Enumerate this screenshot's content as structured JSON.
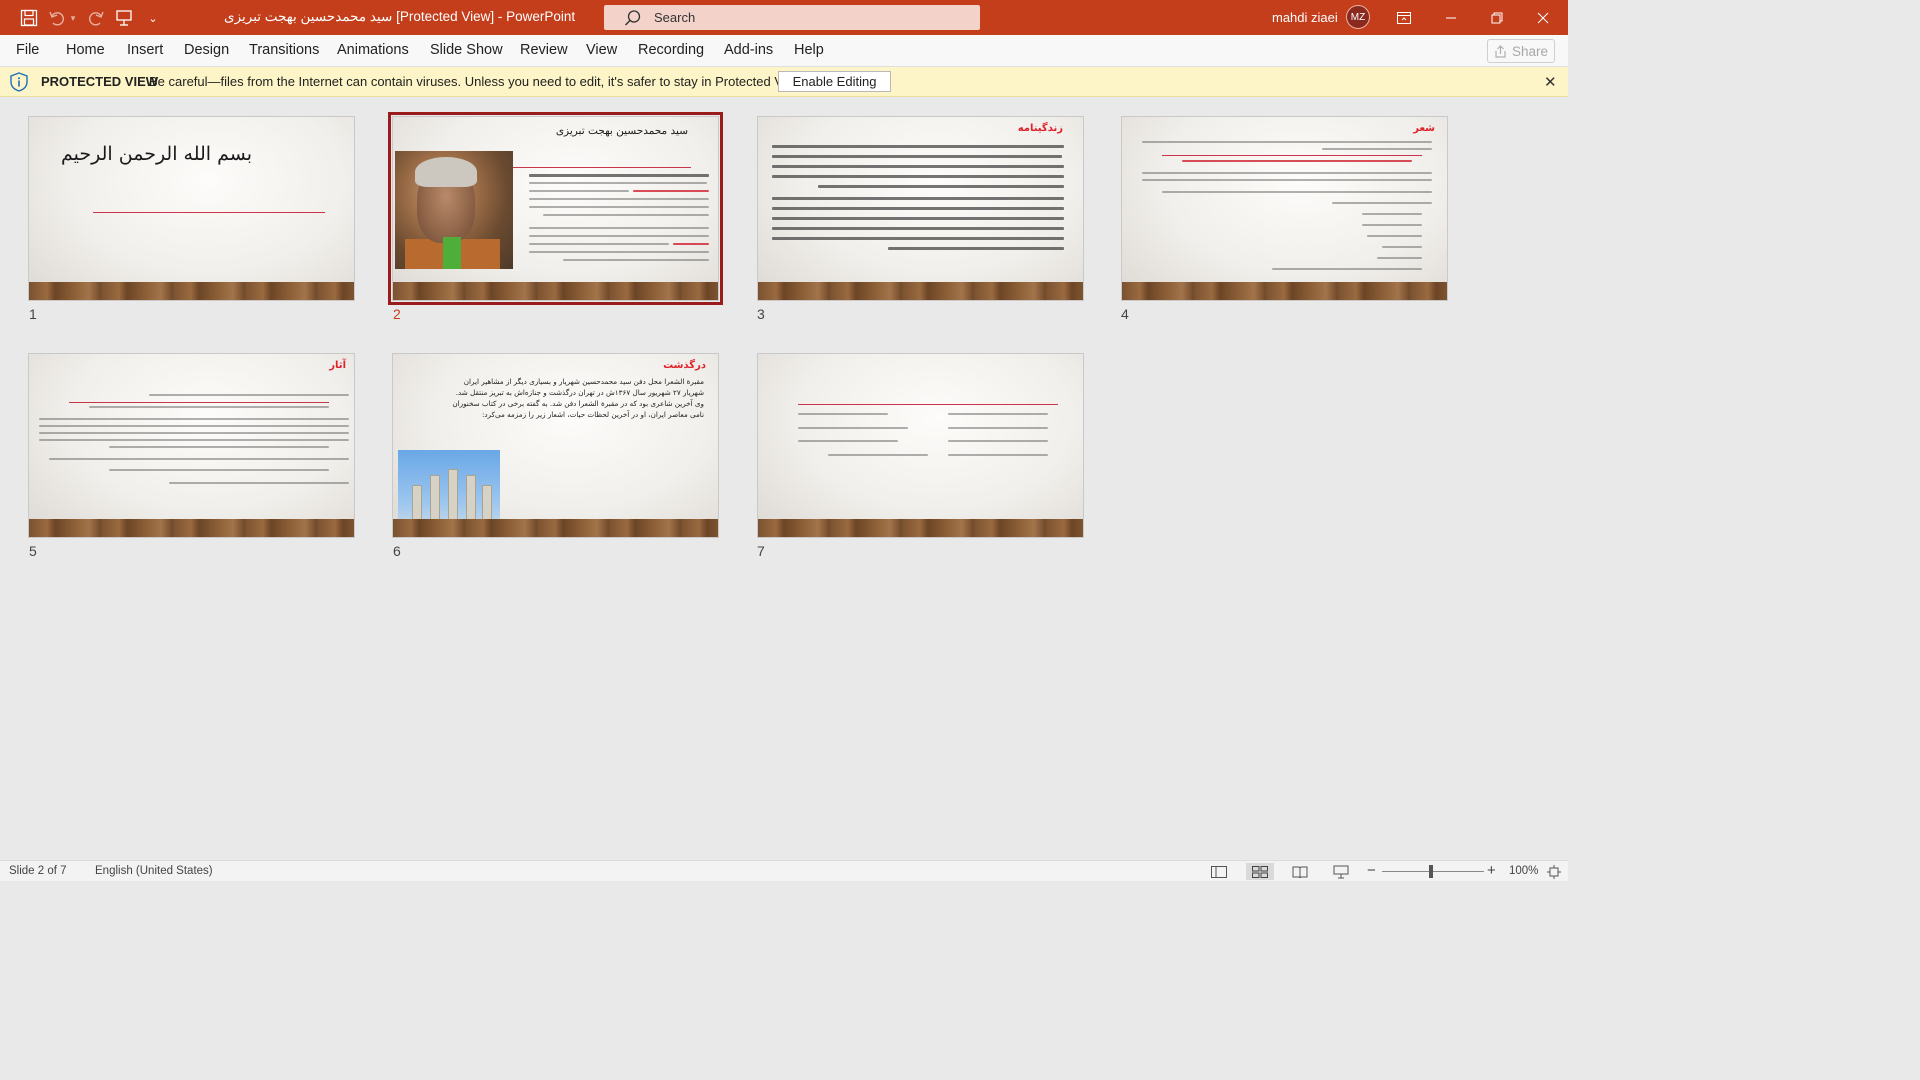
{
  "app": {
    "window_title": "سید محمدحسین بهجت تبریزی [Protected View]  -  PowerPoint",
    "search_placeholder": "Search",
    "user_name": "mahdi ziaei",
    "user_initials": "MZ",
    "brand_color": "#c43e1c"
  },
  "menu": {
    "items": [
      "File",
      "Home",
      "Insert",
      "Design",
      "Transitions",
      "Animations",
      "Slide Show",
      "Review",
      "View",
      "Recording",
      "Add-ins",
      "Help"
    ],
    "share_label": "Share"
  },
  "protected_view": {
    "title": "PROTECTED VIEW",
    "message": "Be careful—files from the Internet can contain viruses. Unless you need to edit, it's safer to stay in Protected View.",
    "button_label": "Enable Editing"
  },
  "slides": [
    {
      "number": "1",
      "title": "بسم الله الرحمن الرحیم",
      "selected": false
    },
    {
      "number": "2",
      "title": "سید محمدحسین بهجت تبریزی",
      "selected": true
    },
    {
      "number": "3",
      "title": "زندگینامه",
      "selected": false
    },
    {
      "number": "4",
      "title": "شعر",
      "selected": false
    },
    {
      "number": "5",
      "title": "آثار",
      "selected": false
    },
    {
      "number": "6",
      "title": "درگذشت",
      "selected": false,
      "lines": [
        "مقبرة الشعرا محل دفن سید محمدحسین شهریار و بسیاری دیگر از مشاهیر ایران",
        "شهریار ۲۷ شهریور سال ۱۳۶۷ش در تهران درگذشت و جنازه‌اش به تبریز منتقل شد.",
        "وی آخرین شاعری بود که در مقبرة الشعرا دفن شد. به گفته برخی در کتاب سخنوران",
        "نامی معاصر ایران، او در آخرین لحظات حیات، اشعار زیر را زمزمه می‌کرد:"
      ]
    },
    {
      "number": "7",
      "title": "",
      "selected": false
    }
  ],
  "status": {
    "slide_indicator": "Slide 2 of 7",
    "language": "English (United States)",
    "zoom": "100%"
  }
}
